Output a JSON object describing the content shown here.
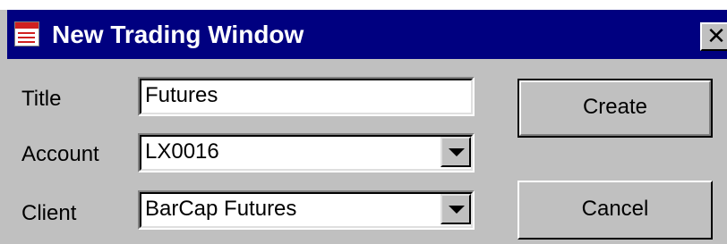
{
  "window": {
    "title": "New Trading Window",
    "close_glyph": "✕",
    "icons": {
      "app": "document-icon",
      "close": "close-icon",
      "dropdown": "chevron-down-icon"
    },
    "colors": {
      "title_bar": "#000080",
      "face": "#c0c0c0",
      "field_bg": "#ffffff"
    }
  },
  "form": {
    "title": {
      "label": "Title",
      "value": "Futures"
    },
    "account": {
      "label": "Account",
      "value": "LX0016"
    },
    "client": {
      "label": "Client",
      "value": "BarCap Futures"
    }
  },
  "buttons": {
    "create": "Create",
    "cancel": "Cancel"
  }
}
